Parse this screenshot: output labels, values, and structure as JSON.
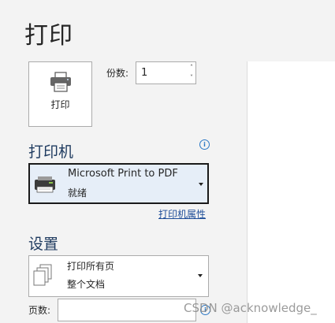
{
  "page_title": "打印",
  "print_button": {
    "label": "打印",
    "icon": "printer-icon"
  },
  "copies": {
    "label": "份数:",
    "value": "1"
  },
  "printer": {
    "heading": "打印机",
    "selected_name": "Microsoft Print to PDF",
    "selected_status": "就绪",
    "properties_link": "打印机属性"
  },
  "settings": {
    "heading": "设置",
    "range_line1": "打印所有页",
    "range_line2": "整个文档",
    "pages_label": "页数:",
    "pages_value": ""
  },
  "watermark": "CSDN @acknowledge_",
  "colors": {
    "heading": "#1e3a5f",
    "link": "#1f4e99",
    "info": "#2b78c5",
    "selected_bg": "#e6eef8"
  }
}
